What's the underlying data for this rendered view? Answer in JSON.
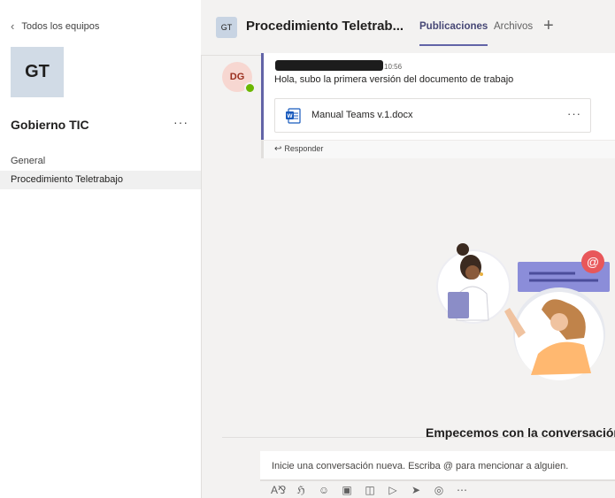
{
  "left_panel": {
    "back_label": "Todos los equipos",
    "team_initials": "GT",
    "team_name": "Gobierno TIC",
    "more_label": "···",
    "channels": [
      {
        "label": "General"
      },
      {
        "label": "Procedimiento Teletrabajo"
      }
    ]
  },
  "header": {
    "team_initials": "GT",
    "channel_title": "Procedimiento Teletrab...",
    "tabs": [
      {
        "label": "Publicaciones"
      },
      {
        "label": "Archivos"
      }
    ],
    "add_tab_label": "+"
  },
  "post": {
    "avatar_initials": "DG",
    "time": "10:56",
    "text": "Hola, subo la primera versión del documento de trabajo",
    "attachment_name": "Manual Teams v.1.docx",
    "attachment_more": "···",
    "reply_label": "Responder"
  },
  "empty_state": {
    "title": "Empecemos con la conversación"
  },
  "compose": {
    "placeholder": "Inicie una conversación nueva. Escriba @ para mencionar a alguien."
  },
  "colors": {
    "accent": "#6264a7",
    "presence": "#6bb700",
    "word": "#185abd"
  },
  "toolbar_icons": [
    "format-icon",
    "attach-icon",
    "emoji-icon",
    "giphy-icon",
    "sticker-icon",
    "meet-icon",
    "send-icon",
    "praise-icon",
    "more-icon"
  ]
}
